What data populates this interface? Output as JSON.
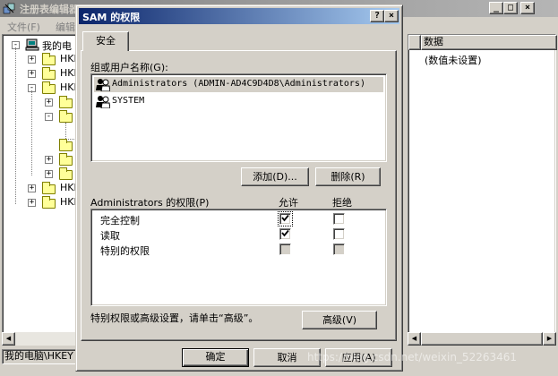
{
  "regedit": {
    "title": "注册表编辑器",
    "menu": [
      "文件(F)",
      "编辑"
    ],
    "tree": [
      {
        "label": "我的电",
        "level": 0,
        "expander": "-"
      },
      {
        "label": "HKE",
        "level": 1,
        "expander": "+"
      },
      {
        "label": "HKE",
        "level": 1,
        "expander": "+"
      },
      {
        "label": "HKE",
        "level": 1,
        "expander": "-"
      },
      {
        "label": "",
        "level": 2,
        "expander": "+"
      },
      {
        "label": "",
        "level": 2,
        "expander": "-"
      },
      {
        "label": "",
        "level": 3,
        "expander": ""
      },
      {
        "label": "",
        "level": 2,
        "expander": ""
      },
      {
        "label": "",
        "level": 2,
        "expander": "+"
      },
      {
        "label": "",
        "level": 2,
        "expander": "+"
      },
      {
        "label": "HKE",
        "level": 1,
        "expander": "+"
      },
      {
        "label": "HKE",
        "level": 1,
        "expander": "+"
      }
    ],
    "list_header_data": "数据",
    "list_value": "(数值未设置)",
    "status": "我的电脑\\HKEY"
  },
  "dialog": {
    "title": "SAM 的权限",
    "tab": "安全",
    "group_label": "组或用户名称(G):",
    "users": [
      {
        "name": "Administrators (ADMIN-AD4C9D4D8\\Administrators)",
        "selected": true
      },
      {
        "name": "SYSTEM",
        "selected": false
      }
    ],
    "add_label": "添加(D)...",
    "remove_label": "删除(R)",
    "perm_label": "Administrators 的权限(P)",
    "allow_label": "允许",
    "deny_label": "拒绝",
    "permissions": [
      {
        "name": "完全控制",
        "allow": true,
        "deny": false,
        "disabled": false
      },
      {
        "name": "读取",
        "allow": true,
        "deny": false,
        "disabled": false
      },
      {
        "name": "特别的权限",
        "allow": false,
        "deny": false,
        "disabled": true
      }
    ],
    "advanced_text": "特别权限或高级设置，请单击“高级”。",
    "advanced_label": "高级(V)",
    "ok_label": "确定",
    "cancel_label": "取消",
    "apply_label": "应用(A)"
  },
  "watermark": "https://blog.csdn.net/weixin_52263461",
  "colors": {
    "titlebar_active": "#0a246a",
    "face": "#d4d0c8",
    "desktop": "#3a6ea5"
  }
}
